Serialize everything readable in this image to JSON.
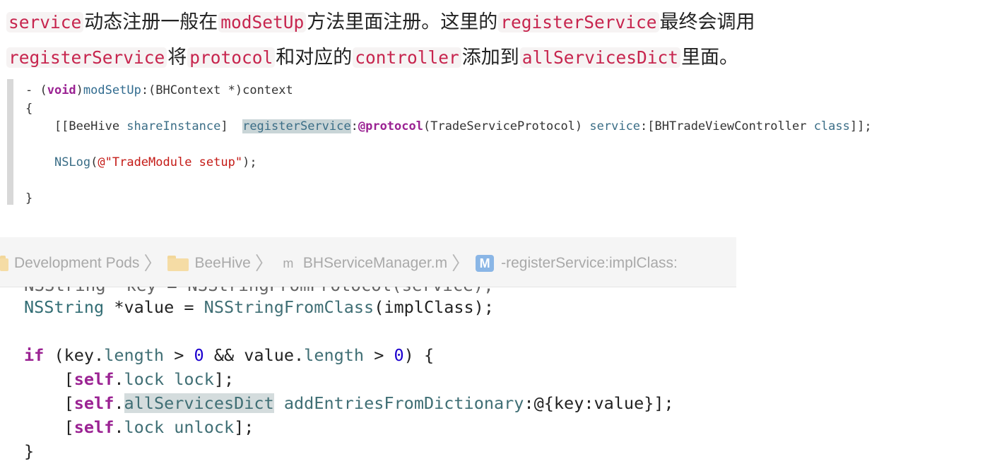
{
  "paragraph": {
    "line1": {
      "c1": "service",
      "t1": "动态注册一般在",
      "c2": "modSetUp",
      "t2": "方法里面注册。这里的",
      "c3": "registerService",
      "t3": "最终会调用"
    },
    "line2": {
      "c1": "registerService",
      "t1": "将",
      "c2": "protocol",
      "t2": "和对应的",
      "c3": "controller",
      "t3": "添加到",
      "c4": "allServicesDict",
      "t4": "里面。"
    }
  },
  "snippet1": {
    "l1": {
      "a": "- (",
      "b": "void",
      "c": ")",
      "d": "modSetUp",
      "e": ":(BHContext *)context"
    },
    "l2": "{",
    "l3": {
      "a": "    [[BeeHive ",
      "b": "shareInstance",
      "c": "]  ",
      "d": "registerService",
      "e": ":",
      "f": "@protocol",
      "g": "(TradeServiceProtocol) ",
      "h": "service",
      "i": ":[BHTradeViewController ",
      "j": "class",
      "k": "]];"
    },
    "l4": "",
    "l5": {
      "a": "    ",
      "b": "NSLog",
      "c": "(",
      "d": "@\"TradeModule setup\"",
      "e": ");"
    },
    "l6": "",
    "l7": "}"
  },
  "breadcrumb": {
    "items": [
      "Development Pods",
      "BeeHive",
      "BHServiceManager.m",
      "-registerService:implClass:"
    ],
    "file_letter": "m",
    "method_letter": "M"
  },
  "snippet2": {
    "cut_line": "NSString *key = NSStringFromProtocol(service);",
    "l1": {
      "a": "NSString",
      "b": " *value = ",
      "c": "NSStringFromClass",
      "d": "(implClass);"
    },
    "l2": "",
    "l3": {
      "a": "if",
      "b": " (key.",
      "c": "length",
      "d": " > ",
      "e": "0",
      "f": " && value.",
      "g": "length",
      "h": " > ",
      "i": "0",
      "j": ") {"
    },
    "l4": {
      "a": "    [",
      "b": "self",
      "c": ".",
      "d": "lock",
      "e": " ",
      "f": "lock",
      "g": "];"
    },
    "l5": {
      "a": "    [",
      "b": "self",
      "c": ".",
      "d": "allServicesDict",
      "e": " ",
      "f": "addEntriesFromDictionary",
      "g": ":@{key:value}];"
    },
    "l6": {
      "a": "    [",
      "b": "self",
      "c": ".",
      "d": "lock",
      "e": " ",
      "f": "unlock",
      "g": "];"
    },
    "l7": "}"
  },
  "colors": {
    "inline_code_text": "#c7254e",
    "inline_code_bg": "#f6f3f3",
    "keyword": "#9b2393",
    "string": "#c41a16",
    "number": "#1c00cf",
    "method_highlight": "#d4dcdd",
    "breadcrumb_bg": "#f5f5f5"
  }
}
